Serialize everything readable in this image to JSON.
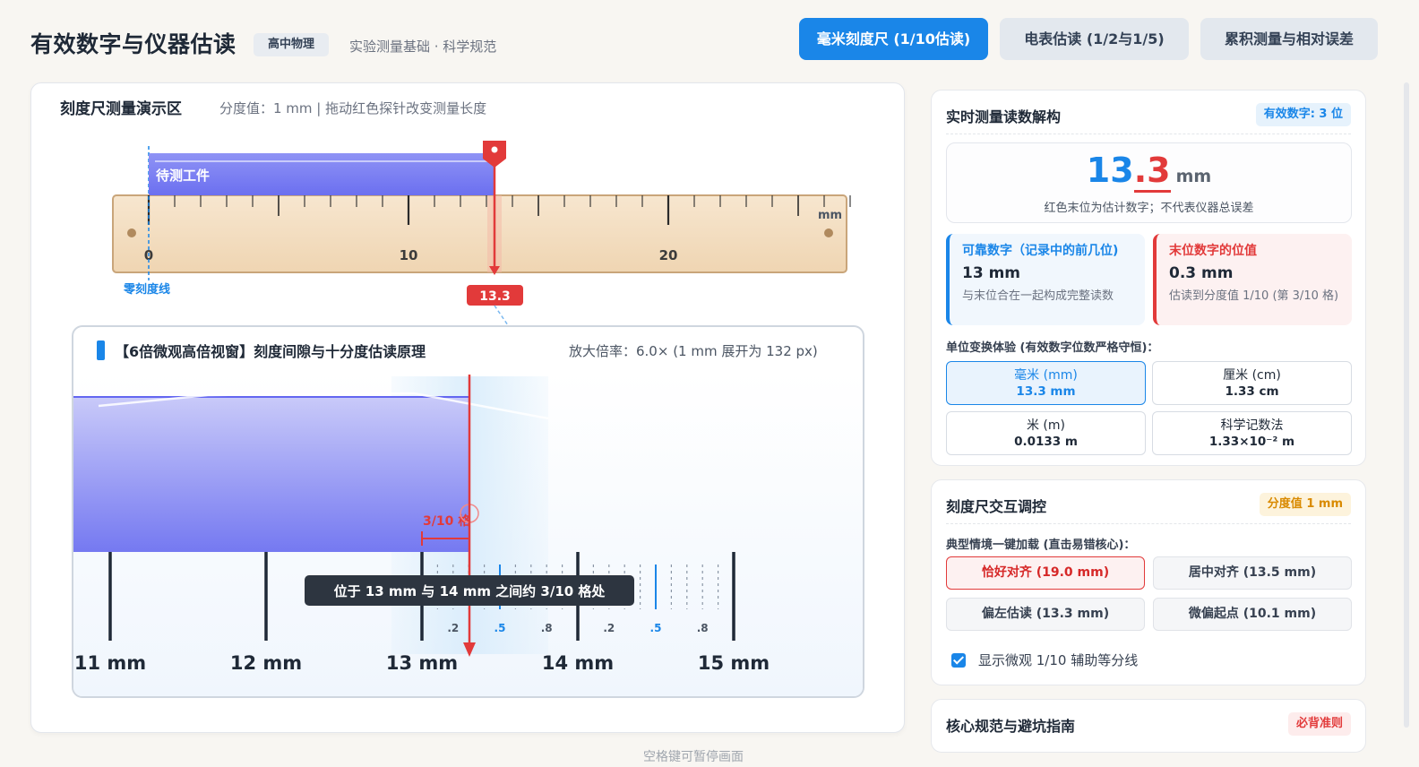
{
  "header": {
    "title": "有效数字与仪器估读",
    "badge": "高中物理",
    "subtitle": "实验测量基础 · 科学规范",
    "tabs": [
      {
        "label": "毫米刻度尺 (1/10估读)",
        "active": true
      },
      {
        "label": "电表估读 (1/2与1/5)",
        "active": false
      },
      {
        "label": "累积测量与相对误差",
        "active": false
      }
    ]
  },
  "demo": {
    "title": "刻度尺测量演示区",
    "hint": "分度值：1 mm | 拖动红色探针改变测量长度",
    "workpiece_label": "待测工件",
    "unit_label": "mm",
    "major_labels": [
      "0",
      "10",
      "20"
    ],
    "zero_line_label": "零刻度线",
    "probe_value": "13.3",
    "measured_mm": 13.3
  },
  "zoom": {
    "title": "【6倍微观高倍视窗】刻度间隙与十分度估读原理",
    "info": "放大倍率：6.0× (1 mm 展开为 132 px)",
    "mm_labels": [
      "11 mm",
      "12 mm",
      "13 mm",
      "14 mm",
      "15 mm"
    ],
    "sub_labels": [
      ".2",
      ".5",
      ".8",
      ".2",
      ".5",
      ".8"
    ],
    "fraction_label": "3/10 格",
    "tooltip": "位于 13 mm 与 14 mm 之间约 3/10 格处"
  },
  "pause_hint": "空格键可暂停画面",
  "reading": {
    "title": "实时测量读数解构",
    "badge": "有效数字: 3 位",
    "value_reliable": "13",
    "value_estimated": ".3",
    "unit": "mm",
    "note": "红色末位为估计数字；不代表仪器总误差",
    "reliable": {
      "head": "可靠数字（记录中的前几位)",
      "value": "13 mm",
      "desc": "与末位合在一起构成完整读数"
    },
    "estimated": {
      "head": "末位数字的位值",
      "value": "0.3 mm",
      "desc": "估读到分度值 1/10 (第 3/10 格)"
    },
    "unit_section_label": "单位变换体验 (有效数字位数严格守恒)：",
    "units": [
      {
        "name": "毫米 (mm)",
        "value": "13.3 mm",
        "active": true
      },
      {
        "name": "厘米 (cm)",
        "value": "1.33 cm",
        "active": false
      },
      {
        "name": "米 (m)",
        "value": "0.0133 m",
        "active": false
      },
      {
        "name": "科学记数法",
        "value": "1.33×10⁻² m",
        "active": false
      }
    ]
  },
  "controls": {
    "title": "刻度尺交互调控",
    "badge": "分度值 1 mm",
    "scenario_label": "典型情境一键加载 (直击易错核心)：",
    "scenarios": [
      {
        "label": "恰好对齐 (19.0 mm)",
        "active": true
      },
      {
        "label": "居中对齐 (13.5 mm)",
        "active": false
      },
      {
        "label": "偏左估读 (13.3 mm)",
        "active": false
      },
      {
        "label": "微偏起点 (10.1 mm)",
        "active": false
      }
    ],
    "checkbox_label": "显示微观 1/10 辅助等分线",
    "checkbox_checked": true
  },
  "guide": {
    "title": "核心规范与避坑指南",
    "badge": "必背准则"
  },
  "colors": {
    "accent": "#1a86e8",
    "estimate_red": "#e23a3a",
    "ruler_wood": "#f3dfc3",
    "workpiece": "#7b7ff0"
  }
}
